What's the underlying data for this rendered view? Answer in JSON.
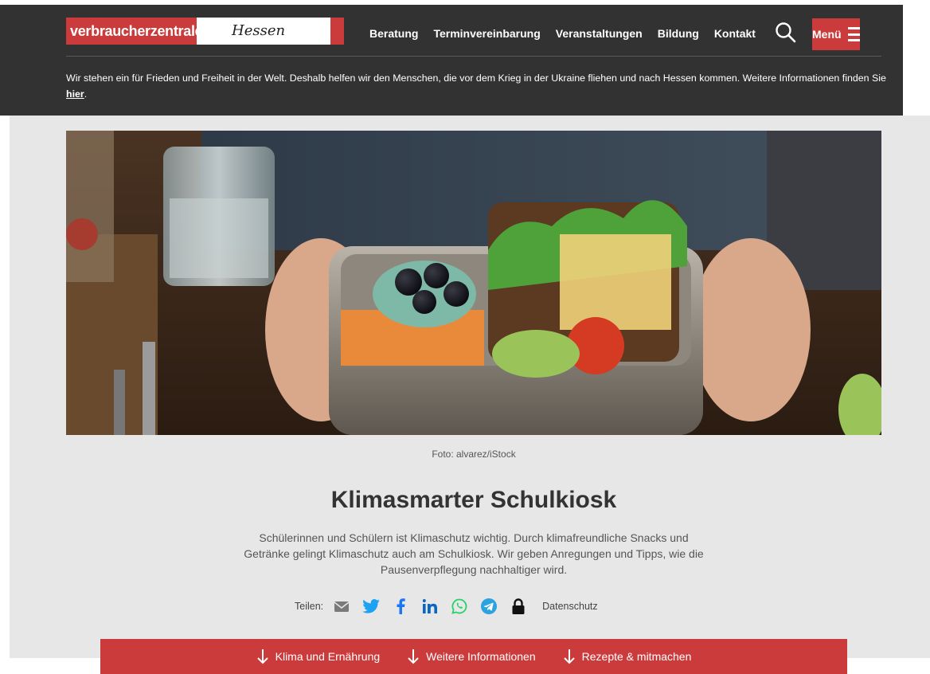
{
  "logo": {
    "brand": "verbraucherzentrale",
    "region": "Hessen"
  },
  "nav": {
    "items": [
      {
        "label": "Beratung"
      },
      {
        "label": "Terminvereinbarung"
      },
      {
        "label": "Veranstaltungen"
      },
      {
        "label": "Bildung"
      },
      {
        "label": "Kontakt"
      }
    ],
    "menu_label": "Menü"
  },
  "notice": {
    "text": "Wir stehen ein für Frieden und Freiheit in der Welt. Deshalb helfen wir den Menschen, die vor dem Krieg in der Ukraine fliehen und nach Hessen kommen. Weitere Informationen finden Sie ",
    "link": "hier",
    "end": "."
  },
  "article": {
    "photo_credit": "Foto: alvarez/iStock",
    "title": "Klimasmarter Schulkiosk",
    "intro": "Schülerinnen und Schülern ist Klimaschutz wichtig. Durch klimafreundliche Snacks und Getränke gelingt Klimaschutz auch am Schulkiosk. Wir geben Anregungen und Tipps, wie die Pausenverpflegung nachhaltiger wird."
  },
  "share": {
    "label": "Teilen:",
    "privacy": "Datenschutz",
    "icons": [
      "email-icon",
      "twitter-icon",
      "facebook-icon",
      "linkedin-icon",
      "whatsapp-icon",
      "telegram-icon",
      "lock-icon"
    ]
  },
  "anchors": [
    {
      "label": "Klima und Ernährung"
    },
    {
      "label": "Weitere Informationen"
    },
    {
      "label": "Rezepte & mitmachen"
    }
  ],
  "colors": {
    "brand_red": "#cc3b3b",
    "header_bg": "#333232",
    "content_bg": "#e8e7e7",
    "twitter": "#1da1f2",
    "facebook": "#1877f2",
    "linkedin": "#0a66c2",
    "whatsapp": "#25d366",
    "telegram": "#2aa3df"
  }
}
